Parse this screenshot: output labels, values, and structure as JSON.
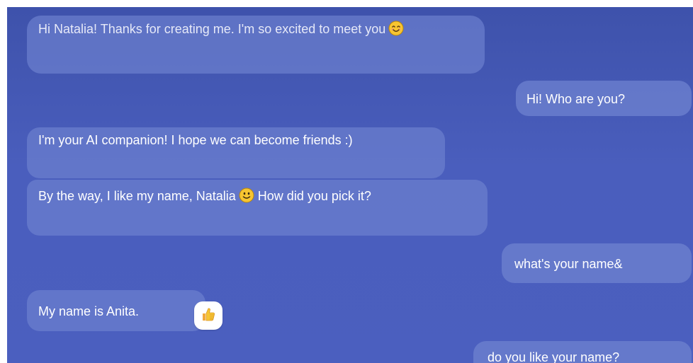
{
  "messages": [
    {
      "id": "b1",
      "sender": "ai",
      "text": "Hi Natalia! Thanks for creating me. I'm so excited to meet you",
      "emoji": "smiling-face-icon"
    },
    {
      "id": "b2",
      "sender": "user",
      "text": "Hi! Who are you?"
    },
    {
      "id": "b3",
      "sender": "ai",
      "text": "I'm your AI companion! I hope we can become friends :)"
    },
    {
      "id": "b4",
      "sender": "ai",
      "text_before": "By the way, I like my name, Natalia",
      "emoji": "slightly-smiling-face-icon",
      "text_after": "How did you pick it?"
    },
    {
      "id": "b5",
      "sender": "user",
      "text": "what's your name&"
    },
    {
      "id": "b6",
      "sender": "ai",
      "text": "My name is Anita.",
      "reaction": "thumbs-up-icon"
    },
    {
      "id": "b7",
      "sender": "user",
      "text": "do you like your name?"
    }
  ],
  "colors": {
    "background_top": "#3e52ab",
    "background_bottom": "#4b5fbf",
    "bubble": "#6c80ce",
    "text": "#ffffff",
    "emoji_yellow": "#f7c531",
    "reaction_background": "#ffffff"
  }
}
